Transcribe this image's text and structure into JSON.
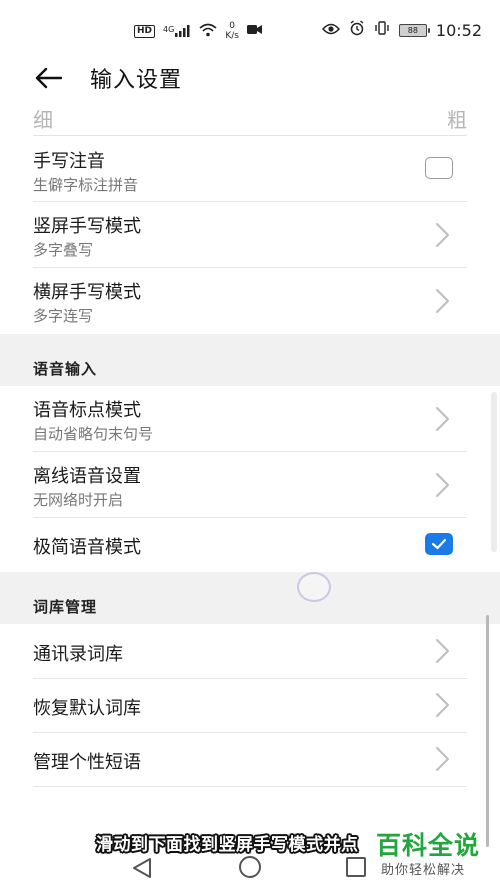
{
  "status_bar": {
    "hd": "HD",
    "network": "4G",
    "speed_value": "0",
    "speed_unit": "K/s",
    "battery": "88",
    "time": "10:52"
  },
  "header": {
    "title": "输入设置"
  },
  "thickness": {
    "thin": "细",
    "thick": "粗"
  },
  "handwriting_rows": [
    {
      "title": "手写注音",
      "subtitle": "生僻字标注拼音",
      "control": "checkbox",
      "checked": false
    },
    {
      "title": "竖屏手写模式",
      "subtitle": "多字叠写",
      "control": "chevron"
    },
    {
      "title": "横屏手写模式",
      "subtitle": "多字连写",
      "control": "chevron"
    }
  ],
  "voice_section": {
    "label": "语音输入",
    "rows": [
      {
        "title": "语音标点模式",
        "subtitle": "自动省略句末句号",
        "control": "chevron"
      },
      {
        "title": "离线语音设置",
        "subtitle": "无网络时开启",
        "control": "chevron"
      },
      {
        "title": "极简语音模式",
        "control": "checkbox",
        "checked": true
      }
    ]
  },
  "lexicon_section": {
    "label": "词库管理",
    "rows": [
      {
        "title": "通讯录词库",
        "control": "chevron"
      },
      {
        "title": "恢复默认词库",
        "control": "chevron"
      },
      {
        "title": "管理个性短语",
        "control": "chevron"
      }
    ]
  },
  "overlay": {
    "subtitle": "滑动到下面找到竖屏手写模式并点",
    "brand_main": "百科全说",
    "brand_sub": "助你轻松解决"
  },
  "colors": {
    "accent": "#1a7ae8",
    "section_bg": "#f1f1f1",
    "brand_green": "#22a63d"
  }
}
